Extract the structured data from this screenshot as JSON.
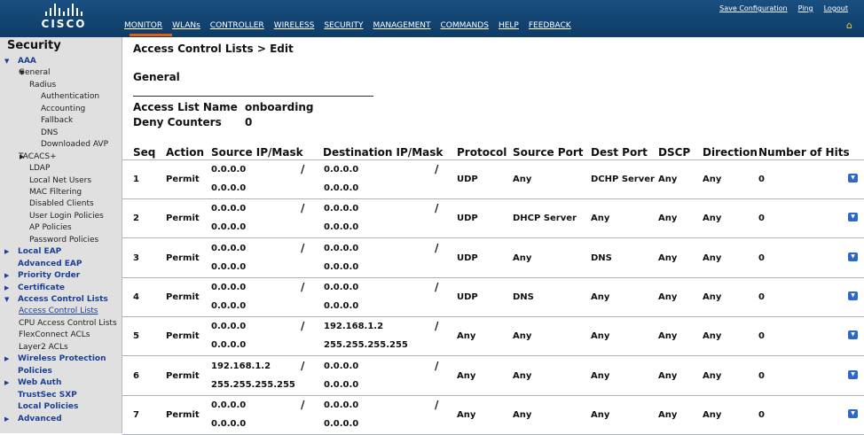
{
  "brand": "CISCO",
  "top_links": [
    "Save Configuration",
    "Ping",
    "Logout"
  ],
  "nav": [
    "MONITOR",
    "WLANs",
    "CONTROLLER",
    "WIRELESS",
    "SECURITY",
    "MANAGEMENT",
    "COMMANDS",
    "HELP",
    "FEEDBACK"
  ],
  "sidebar": {
    "title": "Security",
    "items": [
      {
        "label": "AAA",
        "style": "blue",
        "indent": 0,
        "arrow": "down"
      },
      {
        "label": "General",
        "style": "plain",
        "indent": 1,
        "arrow": "down-dark"
      },
      {
        "label": "Radius",
        "style": "plain",
        "indent": 2,
        "arrow": ""
      },
      {
        "label": "Authentication",
        "style": "plain",
        "indent": 3,
        "arrow": ""
      },
      {
        "label": "Accounting",
        "style": "plain",
        "indent": 3,
        "arrow": ""
      },
      {
        "label": "Fallback",
        "style": "plain",
        "indent": 3,
        "arrow": ""
      },
      {
        "label": "DNS",
        "style": "plain",
        "indent": 3,
        "arrow": ""
      },
      {
        "label": "Downloaded AVP",
        "style": "plain",
        "indent": 3,
        "arrow": ""
      },
      {
        "label": "TACACS+",
        "style": "plain",
        "indent": 1,
        "arrow": "right-dark"
      },
      {
        "label": "LDAP",
        "style": "plain",
        "indent": 2,
        "arrow": ""
      },
      {
        "label": "Local Net Users",
        "style": "plain",
        "indent": 2,
        "arrow": ""
      },
      {
        "label": "MAC Filtering",
        "style": "plain",
        "indent": 2,
        "arrow": ""
      },
      {
        "label": "Disabled Clients",
        "style": "plain",
        "indent": 2,
        "arrow": ""
      },
      {
        "label": "User Login Policies",
        "style": "plain",
        "indent": 2,
        "arrow": ""
      },
      {
        "label": "AP Policies",
        "style": "plain",
        "indent": 2,
        "arrow": ""
      },
      {
        "label": "Password Policies",
        "style": "plain",
        "indent": 2,
        "arrow": ""
      },
      {
        "label": "Local EAP",
        "style": "blue",
        "indent": 0,
        "arrow": "right"
      },
      {
        "label": "Advanced EAP",
        "style": "blue",
        "indent": 0,
        "arrow": ""
      },
      {
        "label": "Priority Order",
        "style": "blue",
        "indent": 0,
        "arrow": "right"
      },
      {
        "label": "Certificate",
        "style": "blue",
        "indent": 0,
        "arrow": "right"
      },
      {
        "label": "Access Control Lists",
        "style": "blue",
        "indent": 0,
        "arrow": "down"
      },
      {
        "label": "Access Control Lists",
        "style": "link",
        "indent": 1,
        "arrow": ""
      },
      {
        "label": "CPU Access Control Lists",
        "style": "plain",
        "indent": 1,
        "arrow": ""
      },
      {
        "label": "FlexConnect ACLs",
        "style": "plain",
        "indent": 1,
        "arrow": ""
      },
      {
        "label": "Layer2 ACLs",
        "style": "plain",
        "indent": 1,
        "arrow": ""
      },
      {
        "label": "Wireless Protection",
        "style": "blue",
        "indent": 0,
        "arrow": "right"
      },
      {
        "label": "Policies",
        "style": "blue",
        "indent": 0,
        "arrow": ""
      },
      {
        "label": "Web Auth",
        "style": "blue",
        "indent": 0,
        "arrow": "right"
      },
      {
        "label": "TrustSec SXP",
        "style": "blue",
        "indent": 0,
        "arrow": ""
      },
      {
        "label": "Local Policies",
        "style": "blue",
        "indent": 0,
        "arrow": ""
      },
      {
        "label": "Advanced",
        "style": "blue",
        "indent": 0,
        "arrow": "right"
      }
    ]
  },
  "page_title": "Access Control Lists > Edit",
  "general_title": "General",
  "access_list_name_label": "Access List Name",
  "access_list_name": "onboarding",
  "deny_counters_label": "Deny Counters",
  "deny_counters": "0",
  "columns": [
    "Seq",
    "Action",
    "Source IP/Mask",
    "Destination IP/Mask",
    "Protocol",
    "Source Port",
    "Dest Port",
    "DSCP",
    "Direction",
    "Number of Hits"
  ],
  "rows": [
    {
      "seq": "1",
      "action": "Permit",
      "src_ip": "0.0.0.0",
      "src_mask": "0.0.0.0",
      "dst_ip": "0.0.0.0",
      "dst_mask": "0.0.0.0",
      "protocol": "UDP",
      "src_port": "Any",
      "dst_port": "DCHP Server",
      "dscp": "Any",
      "direction": "Any",
      "hits": "0"
    },
    {
      "seq": "2",
      "action": "Permit",
      "src_ip": "0.0.0.0",
      "src_mask": "0.0.0.0",
      "dst_ip": "0.0.0.0",
      "dst_mask": "0.0.0.0",
      "protocol": "UDP",
      "src_port": "DHCP Server",
      "dst_port": "Any",
      "dscp": "Any",
      "direction": "Any",
      "hits": "0"
    },
    {
      "seq": "3",
      "action": "Permit",
      "src_ip": "0.0.0.0",
      "src_mask": "0.0.0.0",
      "dst_ip": "0.0.0.0",
      "dst_mask": "0.0.0.0",
      "protocol": "UDP",
      "src_port": "Any",
      "dst_port": "DNS",
      "dscp": "Any",
      "direction": "Any",
      "hits": "0"
    },
    {
      "seq": "4",
      "action": "Permit",
      "src_ip": "0.0.0.0",
      "src_mask": "0.0.0.0",
      "dst_ip": "0.0.0.0",
      "dst_mask": "0.0.0.0",
      "protocol": "UDP",
      "src_port": "DNS",
      "dst_port": "Any",
      "dscp": "Any",
      "direction": "Any",
      "hits": "0"
    },
    {
      "seq": "5",
      "action": "Permit",
      "src_ip": "0.0.0.0",
      "src_mask": "0.0.0.0",
      "dst_ip": "192.168.1.2",
      "dst_mask": "255.255.255.255",
      "protocol": "Any",
      "src_port": "Any",
      "dst_port": "Any",
      "dscp": "Any",
      "direction": "Any",
      "hits": "0"
    },
    {
      "seq": "6",
      "action": "Permit",
      "src_ip": "192.168.1.2",
      "src_mask": "255.255.255.255",
      "dst_ip": "0.0.0.0",
      "dst_mask": "0.0.0.0",
      "protocol": "Any",
      "src_port": "Any",
      "dst_port": "Any",
      "dscp": "Any",
      "direction": "Any",
      "hits": "0"
    },
    {
      "seq": "7",
      "action": "Permit",
      "src_ip": "0.0.0.0",
      "src_mask": "0.0.0.0",
      "dst_ip": "0.0.0.0",
      "dst_mask": "0.0.0.0",
      "protocol": "Any",
      "src_port": "Any",
      "dst_port": "Any",
      "dscp": "Any",
      "direction": "Any",
      "hits": "0"
    }
  ],
  "row_action_icon": "chevron-down-icon",
  "colors": {
    "header_bg": "#0e3c66",
    "sidebar_bg": "#e0e0e0",
    "link_blue": "#1c3f94",
    "dropdown_blue": "#2e67c8",
    "active_tab": "#e85c0d"
  }
}
